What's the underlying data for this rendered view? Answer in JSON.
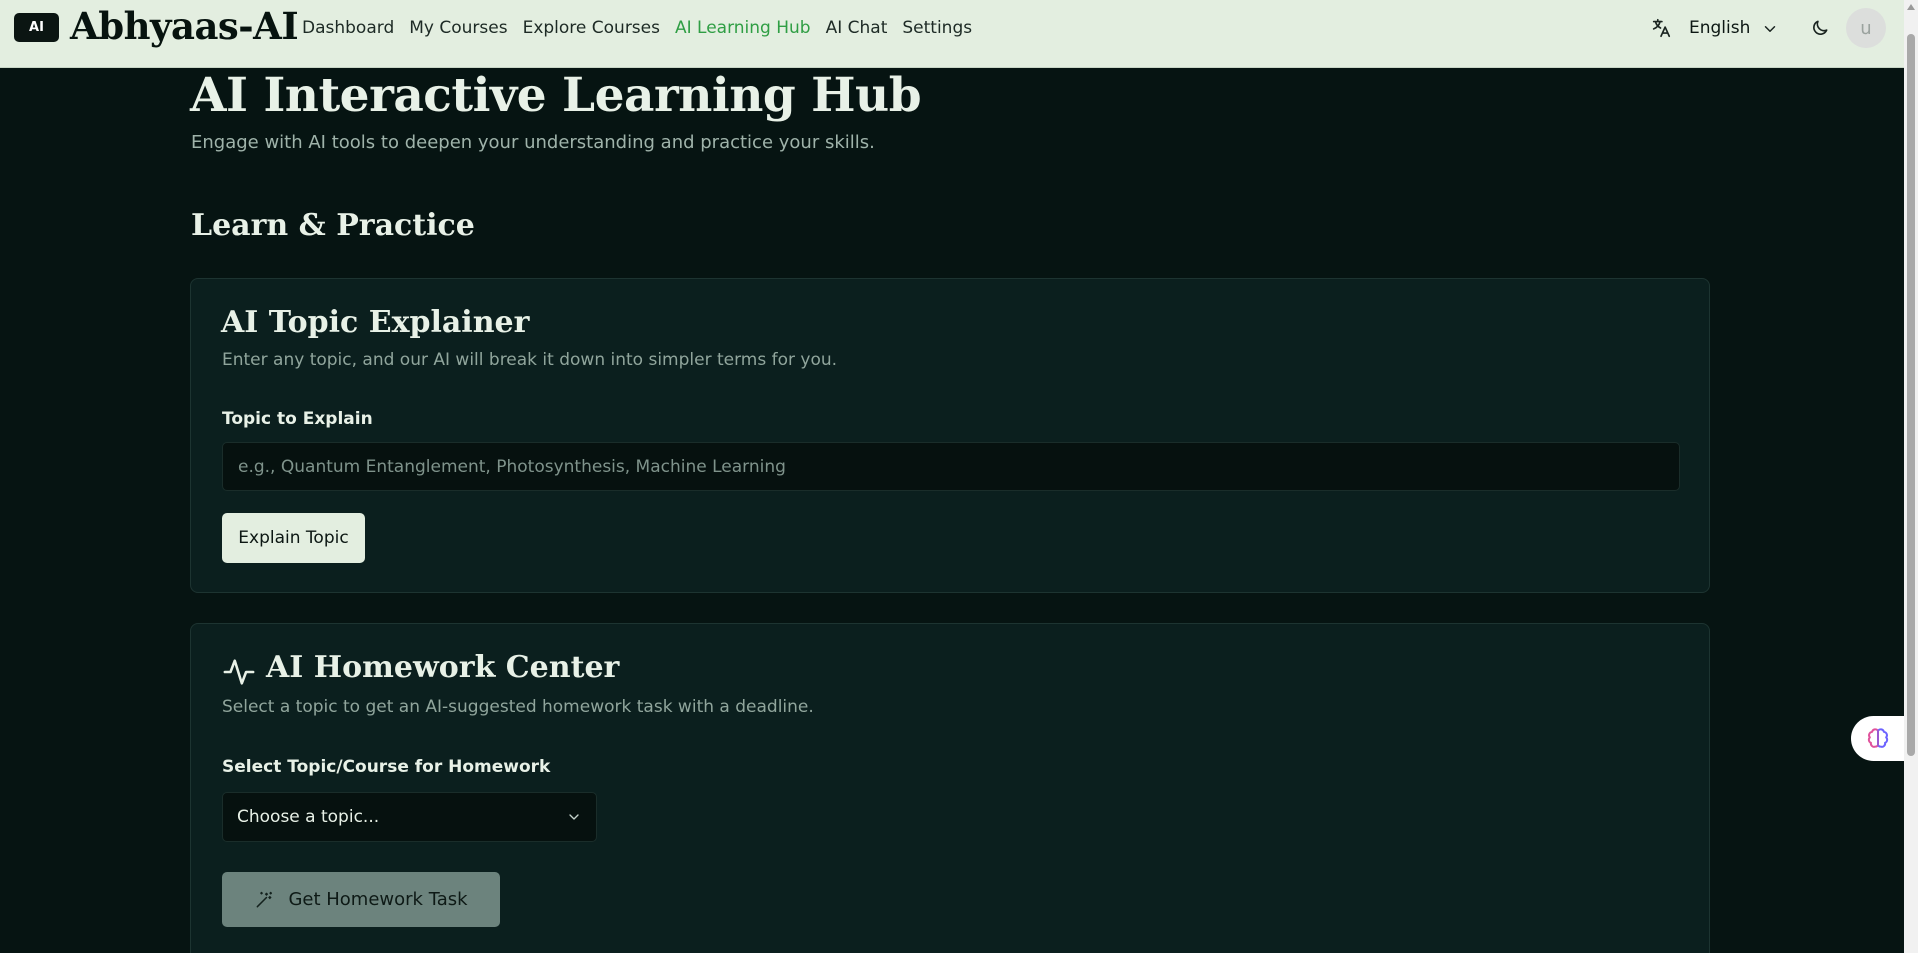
{
  "brand": {
    "logo_text": "AI",
    "name": "Abhyaas-AI"
  },
  "nav": {
    "items": [
      {
        "label": "Dashboard",
        "active": false
      },
      {
        "label": "My Courses",
        "active": false
      },
      {
        "label": "Explore Courses",
        "active": false
      },
      {
        "label": "AI Learning Hub",
        "active": true
      },
      {
        "label": "AI Chat",
        "active": false
      },
      {
        "label": "Settings",
        "active": false
      }
    ]
  },
  "header_right": {
    "language": "English",
    "avatar_initial": "u"
  },
  "page": {
    "title": "AI Interactive Learning Hub",
    "subtitle": "Engage with AI tools to deepen your understanding and practice your skills.",
    "section_title": "Learn & Practice"
  },
  "topic_explainer": {
    "title": "AI Topic Explainer",
    "description": "Enter any topic, and our AI will break it down into simpler terms for you.",
    "field_label": "Topic to Explain",
    "input_value": "",
    "input_placeholder": "e.g., Quantum Entanglement, Photosynthesis, Machine Learning",
    "button_label": "Explain Topic"
  },
  "homework_center": {
    "title": "AI Homework Center",
    "description": "Select a topic to get an AI-suggested homework task with a deadline.",
    "field_label": "Select Topic/Course for Homework",
    "select_value": "Choose a topic...",
    "button_label": "Get Homework Task"
  },
  "colors": {
    "accent": "#2f9e44",
    "background": "#061412",
    "card": "#0b1f1e",
    "topbar": "#e3eee0"
  },
  "icons": {
    "language": "translate-icon",
    "dropdown": "chevron-down-icon",
    "theme": "moon-icon",
    "homework": "activity-icon",
    "wand": "magic-wand-icon",
    "floating": "brain-icon"
  }
}
